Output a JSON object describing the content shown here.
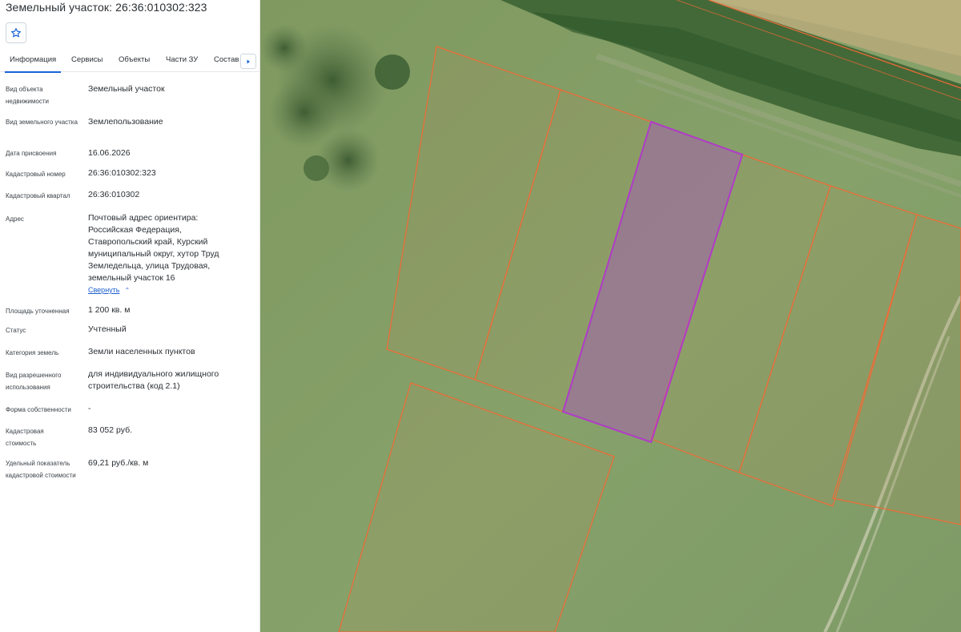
{
  "panel": {
    "title": "Земельный участок: 26:36:010302:323",
    "favorite_icon": "star-outline-icon",
    "tabs": [
      {
        "label": "Информация",
        "active": true
      },
      {
        "label": "Сервисы",
        "active": false
      },
      {
        "label": "Объекты",
        "active": false
      },
      {
        "label": "Части ЗУ",
        "active": false
      },
      {
        "label": "Состав",
        "active": false
      }
    ],
    "tab_scroll_icon": "chevron-right-icon",
    "fields": [
      {
        "label": "Вид объекта недвижимости",
        "value": "Земельный участок"
      },
      {
        "label": "Вид земельного участка",
        "value": "Землепользование"
      },
      {
        "label": "Дата присвоения",
        "value": "16.06.2026"
      },
      {
        "label": "Кадастровый номер",
        "value": "26:36:010302:323"
      },
      {
        "label": "Кадастровый квартал",
        "value": "26:36:010302"
      },
      {
        "label": "Адрес",
        "value": "Почтовый адрес ориентира: Российская Федерация, Ставропольский край, Курский муниципальный округ, хутор Труд Земледельца, улица Трудовая, земельный участок 16"
      },
      {
        "label": "Площадь уточненная",
        "value": "1 200 кв. м"
      },
      {
        "label": "Статус",
        "value": "Учтенный"
      },
      {
        "label": "Категория земель",
        "value": "Земли населенных пунктов"
      },
      {
        "label": "Вид разрешенного использования",
        "value": "для индивидуального жилищного строительства (код 2.1)"
      },
      {
        "label": "Форма собственности",
        "value": "-"
      },
      {
        "label": "Кадастровая стоимость",
        "value": "83 052 руб."
      },
      {
        "label": "Удельный показатель кадастровой стоимости",
        "value": "69,21 руб./кв. м"
      }
    ],
    "collapse_link": "Свернуть"
  },
  "colors": {
    "accent": "#1a63d6",
    "parcel_border": "#f06a35",
    "selected_parcel_border": "#b03bc8",
    "selected_parcel_fill": "#b04cc0"
  }
}
